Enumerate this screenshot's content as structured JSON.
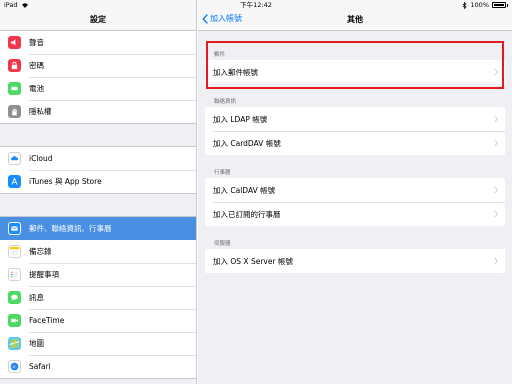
{
  "status_bar": {
    "device": "iPad",
    "time": "下午12:42",
    "battery_pct": "100%"
  },
  "master": {
    "title": "設定",
    "groups": [
      [
        {
          "label": "聲音",
          "icon": "speaker-icon",
          "color": "#f2354a"
        },
        {
          "label": "密碼",
          "icon": "lock-icon",
          "color": "#f2354a"
        },
        {
          "label": "電池",
          "icon": "battery-icon",
          "color": "#4cd964"
        },
        {
          "label": "隱私權",
          "icon": "hand-icon",
          "color": "#8e8e93"
        }
      ],
      [
        {
          "label": "iCloud",
          "icon": "cloud-icon",
          "color": "#ffffff"
        },
        {
          "label": "iTunes 與 App Store",
          "icon": "app-store-icon",
          "color": "#1a8cff"
        }
      ],
      [
        {
          "label": "郵件、聯絡資訊、行事曆",
          "icon": "mail-icon",
          "color": "#1a8cff",
          "selected": true
        },
        {
          "label": "備忘錄",
          "icon": "notes-icon",
          "color": "#ffffff"
        },
        {
          "label": "提醒事項",
          "icon": "reminders-icon",
          "color": "#ffffff"
        },
        {
          "label": "訊息",
          "icon": "message-icon",
          "color": "#4cd964"
        },
        {
          "label": "FaceTime",
          "icon": "video-icon",
          "color": "#4cd964"
        },
        {
          "label": "地圖",
          "icon": "map-icon",
          "color": "#5ac8fa"
        },
        {
          "label": "Safari",
          "icon": "compass-icon",
          "color": "#1a8cff"
        }
      ]
    ]
  },
  "detail": {
    "back_label": "加入帳號",
    "title": "其他",
    "sections": [
      {
        "header": "郵件",
        "rows": [
          "加入郵件帳號"
        ]
      },
      {
        "header": "聯絡資訊",
        "rows": [
          "加入 LDAP 帳號",
          "加入 CardDAV 帳號"
        ]
      },
      {
        "header": "行事曆",
        "rows": [
          "加入 CalDAV 帳號",
          "加入已訂閱的行事曆"
        ]
      },
      {
        "header": "伺服器",
        "rows": [
          "加入 OS X Server 帳號"
        ]
      }
    ]
  },
  "accent_color": "#007aff",
  "highlight_color": "#e21b23"
}
